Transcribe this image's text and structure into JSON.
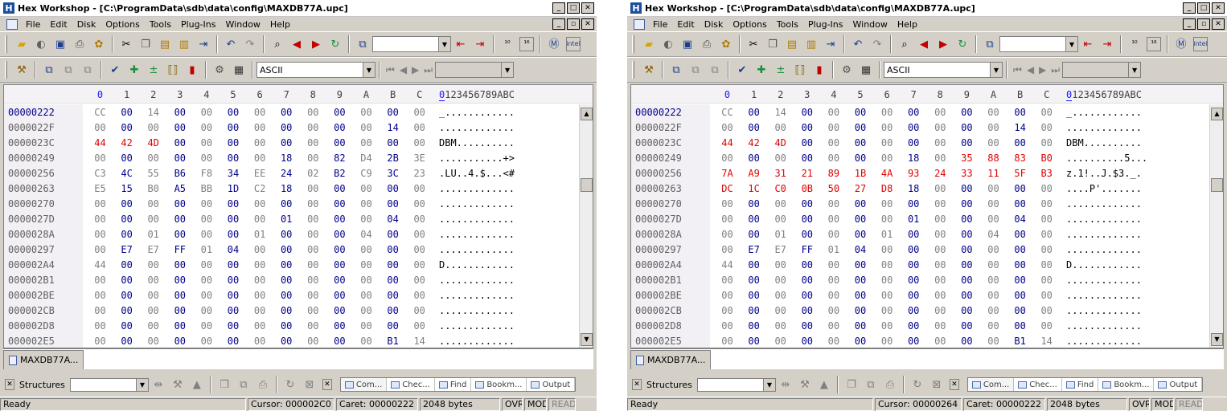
{
  "left": {
    "title": "Hex Workshop - [C:\\ProgramData\\sdb\\data\\config\\MAXDB77A.upc]",
    "menu": [
      "File",
      "Edit",
      "Disk",
      "Options",
      "Tools",
      "Plug-Ins",
      "Window",
      "Help"
    ],
    "encoding": "ASCII",
    "col_headers": [
      "0",
      "1",
      "2",
      "3",
      "4",
      "5",
      "6",
      "7",
      "8",
      "9",
      "A",
      "B",
      "C"
    ],
    "ascii_header_first": "0",
    "ascii_header_rest": "123456789ABC",
    "rows": [
      {
        "off": "00000222",
        "hex": [
          "CC",
          "00",
          "14",
          "00",
          "00",
          "00",
          "00",
          "00",
          "00",
          "00",
          "00",
          "00",
          "00"
        ],
        "ascii": "_............"
      },
      {
        "off": "0000022F",
        "hex": [
          "00",
          "00",
          "00",
          "00",
          "00",
          "00",
          "00",
          "00",
          "00",
          "00",
          "00",
          "14",
          "00"
        ],
        "ascii": "............."
      },
      {
        "off": "0000023C",
        "hex": [
          "44",
          "42",
          "4D",
          "00",
          "00",
          "00",
          "00",
          "00",
          "00",
          "00",
          "00",
          "00",
          "00"
        ],
        "ascii": "DBM.........."
      },
      {
        "off": "00000249",
        "hex": [
          "00",
          "00",
          "00",
          "00",
          "00",
          "00",
          "00",
          "18",
          "00",
          "82",
          "D4",
          "2B",
          "3E"
        ],
        "ascii": "...........+>"
      },
      {
        "off": "00000256",
        "hex": [
          "C3",
          "4C",
          "55",
          "B6",
          "F8",
          "34",
          "EE",
          "24",
          "02",
          "B2",
          "C9",
          "3C",
          "23"
        ],
        "ascii": ".LU..4.$...<#"
      },
      {
        "off": "00000263",
        "hex": [
          "E5",
          "15",
          "B0",
          "A5",
          "BB",
          "1D",
          "C2",
          "18",
          "00",
          "00",
          "00",
          "00",
          "00"
        ],
        "ascii": "............."
      },
      {
        "off": "00000270",
        "hex": [
          "00",
          "00",
          "00",
          "00",
          "00",
          "00",
          "00",
          "00",
          "00",
          "00",
          "00",
          "00",
          "00"
        ],
        "ascii": "............."
      },
      {
        "off": "0000027D",
        "hex": [
          "00",
          "00",
          "00",
          "00",
          "00",
          "00",
          "00",
          "01",
          "00",
          "00",
          "00",
          "04",
          "00"
        ],
        "ascii": "............."
      },
      {
        "off": "0000028A",
        "hex": [
          "00",
          "00",
          "01",
          "00",
          "00",
          "00",
          "01",
          "00",
          "00",
          "00",
          "04",
          "00",
          "00"
        ],
        "ascii": "............."
      },
      {
        "off": "00000297",
        "hex": [
          "00",
          "E7",
          "E7",
          "FF",
          "01",
          "04",
          "00",
          "00",
          "00",
          "00",
          "00",
          "00",
          "00"
        ],
        "ascii": "............."
      },
      {
        "off": "000002A4",
        "hex": [
          "44",
          "00",
          "00",
          "00",
          "00",
          "00",
          "00",
          "00",
          "00",
          "00",
          "00",
          "00",
          "00"
        ],
        "ascii": "D............"
      },
      {
        "off": "000002B1",
        "hex": [
          "00",
          "00",
          "00",
          "00",
          "00",
          "00",
          "00",
          "00",
          "00",
          "00",
          "00",
          "00",
          "00"
        ],
        "ascii": "............."
      },
      {
        "off": "000002BE",
        "hex": [
          "00",
          "00",
          "00",
          "00",
          "00",
          "00",
          "00",
          "00",
          "00",
          "00",
          "00",
          "00",
          "00"
        ],
        "ascii": "............."
      },
      {
        "off": "000002CB",
        "hex": [
          "00",
          "00",
          "00",
          "00",
          "00",
          "00",
          "00",
          "00",
          "00",
          "00",
          "00",
          "00",
          "00"
        ],
        "ascii": "............."
      },
      {
        "off": "000002D8",
        "hex": [
          "00",
          "00",
          "00",
          "00",
          "00",
          "00",
          "00",
          "00",
          "00",
          "00",
          "00",
          "00",
          "00"
        ],
        "ascii": "............."
      },
      {
        "off": "000002E5",
        "hex": [
          "00",
          "00",
          "00",
          "00",
          "00",
          "00",
          "00",
          "00",
          "00",
          "00",
          "00",
          "B1",
          "14"
        ],
        "ascii": "............."
      }
    ],
    "doc_tab": "MAXDB77A...",
    "structures_label": "Structures",
    "pane_tabs": [
      "Com...",
      "Chec...",
      "Find",
      "Bookm...",
      "Output"
    ],
    "status": {
      "ready": "Ready",
      "cursor": "Cursor: 000002C0",
      "caret": "Caret: 00000222",
      "size": "2048 bytes",
      "ovr": "OVR",
      "mod": "MOD",
      "read": "READ"
    }
  },
  "right": {
    "title": "Hex Workshop - [C:\\ProgramData\\sdb\\data\\config\\MAXDB77A.upc]",
    "menu": [
      "File",
      "Edit",
      "Disk",
      "Options",
      "Tools",
      "Plug-Ins",
      "Window",
      "Help"
    ],
    "encoding": "ASCII",
    "col_headers": [
      "0",
      "1",
      "2",
      "3",
      "4",
      "5",
      "6",
      "7",
      "8",
      "9",
      "A",
      "B",
      "C"
    ],
    "ascii_header_first": "0",
    "ascii_header_rest": "123456789ABC",
    "rows": [
      {
        "off": "00000222",
        "hex": [
          "CC",
          "00",
          "14",
          "00",
          "00",
          "00",
          "00",
          "00",
          "00",
          "00",
          "00",
          "00",
          "00"
        ],
        "ascii": "_............"
      },
      {
        "off": "0000022F",
        "hex": [
          "00",
          "00",
          "00",
          "00",
          "00",
          "00",
          "00",
          "00",
          "00",
          "00",
          "00",
          "14",
          "00"
        ],
        "ascii": "............."
      },
      {
        "off": "0000023C",
        "hex": [
          "44",
          "42",
          "4D",
          "00",
          "00",
          "00",
          "00",
          "00",
          "00",
          "00",
          "00",
          "00",
          "00"
        ],
        "ascii": "DBM.........."
      },
      {
        "off": "00000249",
        "hex": [
          "00",
          "00",
          "00",
          "00",
          "00",
          "00",
          "00",
          "18",
          "00",
          "35",
          "88",
          "83",
          "B0"
        ],
        "ascii": "..........5..."
      },
      {
        "off": "00000256",
        "hex": [
          "7A",
          "A9",
          "31",
          "21",
          "89",
          "1B",
          "4A",
          "93",
          "24",
          "33",
          "11",
          "5F",
          "B3"
        ],
        "ascii": "z.1!..J.$3._."
      },
      {
        "off": "00000263",
        "hex": [
          "DC",
          "1C",
          "C0",
          "0B",
          "50",
          "27",
          "D8",
          "18",
          "00",
          "00",
          "00",
          "00",
          "00"
        ],
        "ascii": "....P'......."
      },
      {
        "off": "00000270",
        "hex": [
          "00",
          "00",
          "00",
          "00",
          "00",
          "00",
          "00",
          "00",
          "00",
          "00",
          "00",
          "00",
          "00"
        ],
        "ascii": "............."
      },
      {
        "off": "0000027D",
        "hex": [
          "00",
          "00",
          "00",
          "00",
          "00",
          "00",
          "00",
          "01",
          "00",
          "00",
          "00",
          "04",
          "00"
        ],
        "ascii": "............."
      },
      {
        "off": "0000028A",
        "hex": [
          "00",
          "00",
          "01",
          "00",
          "00",
          "00",
          "01",
          "00",
          "00",
          "00",
          "04",
          "00",
          "00"
        ],
        "ascii": "............."
      },
      {
        "off": "00000297",
        "hex": [
          "00",
          "E7",
          "E7",
          "FF",
          "01",
          "04",
          "00",
          "00",
          "00",
          "00",
          "00",
          "00",
          "00"
        ],
        "ascii": "............."
      },
      {
        "off": "000002A4",
        "hex": [
          "44",
          "00",
          "00",
          "00",
          "00",
          "00",
          "00",
          "00",
          "00",
          "00",
          "00",
          "00",
          "00"
        ],
        "ascii": "D............"
      },
      {
        "off": "000002B1",
        "hex": [
          "00",
          "00",
          "00",
          "00",
          "00",
          "00",
          "00",
          "00",
          "00",
          "00",
          "00",
          "00",
          "00"
        ],
        "ascii": "............."
      },
      {
        "off": "000002BE",
        "hex": [
          "00",
          "00",
          "00",
          "00",
          "00",
          "00",
          "00",
          "00",
          "00",
          "00",
          "00",
          "00",
          "00"
        ],
        "ascii": "............."
      },
      {
        "off": "000002CB",
        "hex": [
          "00",
          "00",
          "00",
          "00",
          "00",
          "00",
          "00",
          "00",
          "00",
          "00",
          "00",
          "00",
          "00"
        ],
        "ascii": "............."
      },
      {
        "off": "000002D8",
        "hex": [
          "00",
          "00",
          "00",
          "00",
          "00",
          "00",
          "00",
          "00",
          "00",
          "00",
          "00",
          "00",
          "00"
        ],
        "ascii": "............."
      },
      {
        "off": "000002E5",
        "hex": [
          "00",
          "00",
          "00",
          "00",
          "00",
          "00",
          "00",
          "00",
          "00",
          "00",
          "00",
          "B1",
          "14"
        ],
        "ascii": "............."
      }
    ],
    "doc_tab": "MAXDB77A...",
    "structures_label": "Structures",
    "pane_tabs": [
      "Com...",
      "Chec...",
      "Find",
      "Bookm...",
      "Output"
    ],
    "status": {
      "ready": "Ready",
      "cursor": "Cursor: 00000264",
      "caret": "Caret: 00000222",
      "size": "2048 bytes",
      "ovr": "OVR",
      "mod": "MOD",
      "read": "READ"
    }
  },
  "colors": {
    "zero": "#808080",
    "nonzero": "#00008b",
    "changed": "#e00000",
    "offset": "#606060"
  }
}
